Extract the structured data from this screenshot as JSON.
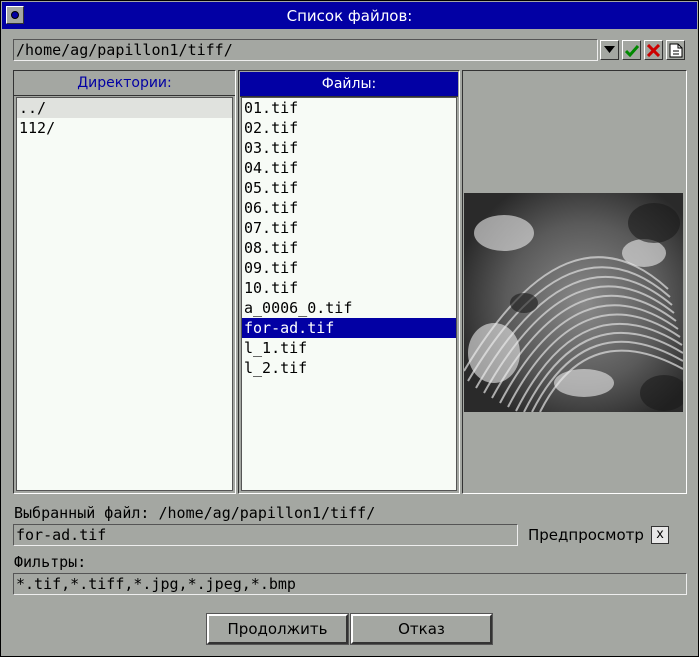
{
  "window": {
    "title": "Список файлов:"
  },
  "path_bar": {
    "value": "/home/ag/papillon1/tiff/"
  },
  "toolbar": {
    "icons": [
      "dropdown-arrow-icon",
      "ok-check-icon",
      "cancel-x-icon",
      "new-file-icon"
    ],
    "colors": {
      "ok": "#008800",
      "cancel": "#cc0000"
    }
  },
  "directories": {
    "header": "Директории:",
    "items": [
      "../",
      "112/"
    ]
  },
  "files": {
    "header": "Файлы:",
    "items": [
      "01.tif",
      "02.tif",
      "03.tif",
      "04.tif",
      "05.tif",
      "06.tif",
      "07.tif",
      "08.tif",
      "09.tif",
      "10.tif",
      "a_0006_0.tif",
      "for-ad.tif",
      "l_1.tif",
      "l_2.tif"
    ],
    "selected": "for-ad.tif"
  },
  "selected_file": {
    "label": "Выбранный файл: /home/ag/papillon1/tiff/",
    "value": "for-ad.tif"
  },
  "preview": {
    "label": "Предпросмотр",
    "checkbox": "x"
  },
  "filters": {
    "label": "Фильтры:",
    "value": "*.tif,*.tiff,*.jpg,*.jpeg,*.bmp"
  },
  "buttons": {
    "continue": "Продолжить",
    "cancel": "Отказ"
  },
  "colors": {
    "title_bg": "#0200a4",
    "selection": "#0200a4",
    "window_bg": "#a4a7a2",
    "list_bg": "#f7fbf6"
  }
}
